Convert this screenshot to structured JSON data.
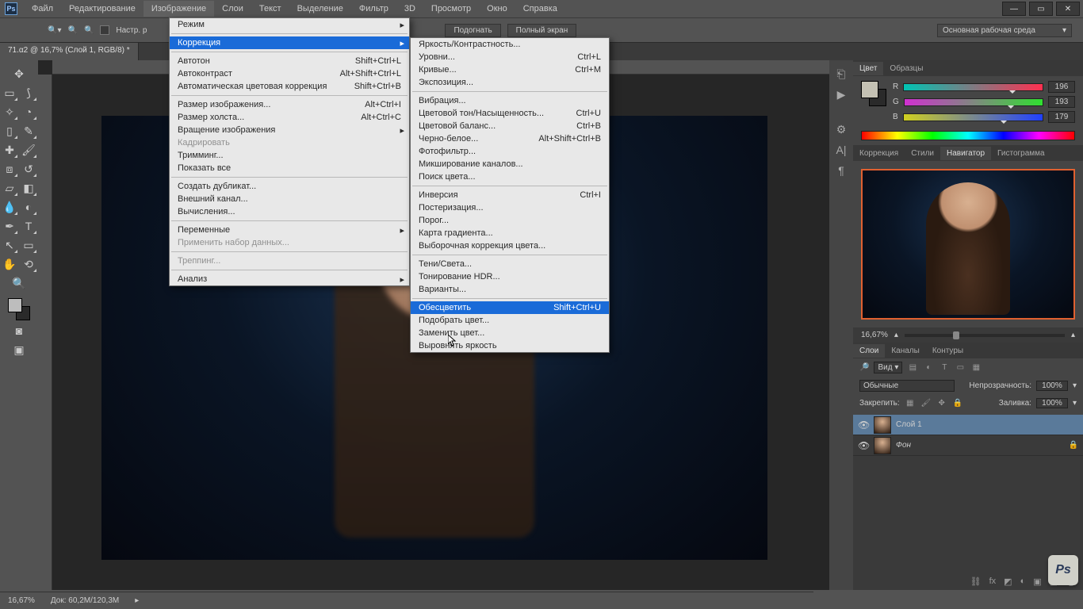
{
  "app": {
    "logo": "Ps",
    "title": "71.α2 @ 16,7% (Слой 1, RGB/8) *"
  },
  "menu": {
    "items": [
      "Файл",
      "Редактирование",
      "Изображение",
      "Слои",
      "Текст",
      "Выделение",
      "Фильтр",
      "3D",
      "Просмотр",
      "Окно",
      "Справка"
    ],
    "active_index": 2
  },
  "optbar": {
    "customize": "Настр. р",
    "fit": "Подогнать",
    "full": "Полный экран",
    "workspace": "Основная рабочая среда"
  },
  "image_menu": [
    {
      "label": "Режим",
      "arrow": true
    },
    {
      "sep": true
    },
    {
      "label": "Коррекция",
      "arrow": true,
      "hl": true
    },
    {
      "sep": true
    },
    {
      "label": "Автотон",
      "sc": "Shift+Ctrl+L"
    },
    {
      "label": "Автоконтраст",
      "sc": "Alt+Shift+Ctrl+L"
    },
    {
      "label": "Автоматическая цветовая коррекция",
      "sc": "Shift+Ctrl+B"
    },
    {
      "sep": true
    },
    {
      "label": "Размер изображения...",
      "sc": "Alt+Ctrl+I"
    },
    {
      "label": "Размер холста...",
      "sc": "Alt+Ctrl+C"
    },
    {
      "label": "Вращение изображения",
      "arrow": true
    },
    {
      "label": "Кадрировать",
      "dis": true
    },
    {
      "label": "Тримминг..."
    },
    {
      "label": "Показать все"
    },
    {
      "sep": true
    },
    {
      "label": "Создать дубликат..."
    },
    {
      "label": "Внешний канал..."
    },
    {
      "label": "Вычисления..."
    },
    {
      "sep": true
    },
    {
      "label": "Переменные",
      "arrow": true
    },
    {
      "label": "Применить набор данных...",
      "dis": true
    },
    {
      "sep": true
    },
    {
      "label": "Треппинг...",
      "dis": true
    },
    {
      "sep": true
    },
    {
      "label": "Анализ",
      "arrow": true
    }
  ],
  "corr_menu": [
    {
      "label": "Яркость/Контрастность..."
    },
    {
      "label": "Уровни...",
      "sc": "Ctrl+L"
    },
    {
      "label": "Кривые...",
      "sc": "Ctrl+M"
    },
    {
      "label": "Экспозиция..."
    },
    {
      "sep": true
    },
    {
      "label": "Вибрация..."
    },
    {
      "label": "Цветовой тон/Насыщенность...",
      "sc": "Ctrl+U"
    },
    {
      "label": "Цветовой баланс...",
      "sc": "Ctrl+B"
    },
    {
      "label": "Черно-белое...",
      "sc": "Alt+Shift+Ctrl+B"
    },
    {
      "label": "Фотофильтр..."
    },
    {
      "label": "Микширование каналов..."
    },
    {
      "label": "Поиск цвета..."
    },
    {
      "sep": true
    },
    {
      "label": "Инверсия",
      "sc": "Ctrl+I"
    },
    {
      "label": "Постеризация..."
    },
    {
      "label": "Порог..."
    },
    {
      "label": "Карта градиента..."
    },
    {
      "label": "Выборочная коррекция цвета..."
    },
    {
      "sep": true
    },
    {
      "label": "Тени/Света..."
    },
    {
      "label": "Тонирование HDR..."
    },
    {
      "label": "Варианты..."
    },
    {
      "sep": true
    },
    {
      "label": "Обесцветить",
      "sc": "Shift+Ctrl+U",
      "hl": true
    },
    {
      "label": "Подобрать цвет..."
    },
    {
      "label": "Заменить цвет..."
    },
    {
      "label": "Выровнять яркость"
    }
  ],
  "panels": {
    "color_tabs": [
      "Цвет",
      "Образцы"
    ],
    "color": {
      "r_label": "R",
      "g_label": "G",
      "b_label": "B",
      "r": "196",
      "g": "193",
      "b": "179"
    },
    "nav_tabs": [
      "Коррекция",
      "Стили",
      "Навигатор",
      "Гистограмма"
    ],
    "nav_zoom": "16,67%",
    "layers_tabs": [
      "Слои",
      "Каналы",
      "Контуры"
    ],
    "layers": {
      "kind": "Вид",
      "blend": "Обычные",
      "opacity_label": "Непрозрачность:",
      "opacity": "100%",
      "lock_label": "Закрепить:",
      "fill_label": "Заливка:",
      "fill": "100%",
      "items": [
        "Слой 1",
        "Фон"
      ]
    }
  },
  "status": {
    "zoom": "16,67%",
    "doc": "Док: 60,2M/120,3M"
  }
}
